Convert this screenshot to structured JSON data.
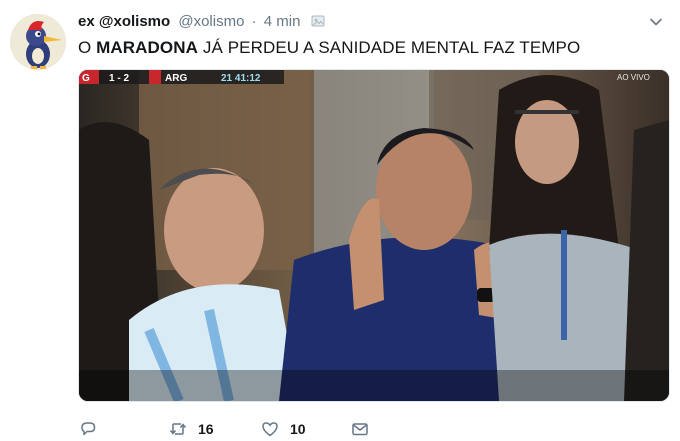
{
  "tweet": {
    "display_name": "ex @xolismo",
    "handle": "@xolismo",
    "separator": "·",
    "time": "4 min",
    "text_prefix": "O ",
    "text_bold": "MARADONA",
    "text_rest": " JÁ PERDEU A SANIDADE MENTAL FAZ TEMPO"
  },
  "media": {
    "scoreboard": {
      "team_left": "G",
      "score": "1 - 2",
      "team_right": "ARG",
      "clock": "21  41:12"
    },
    "live_label": "AO VIVO"
  },
  "actions": {
    "retweet_count": "16",
    "like_count": "10"
  },
  "colors": {
    "text_primary": "#14171a",
    "text_secondary": "#657786",
    "border": "#e1e8ed",
    "scoreboard_red": "#c8262d"
  }
}
